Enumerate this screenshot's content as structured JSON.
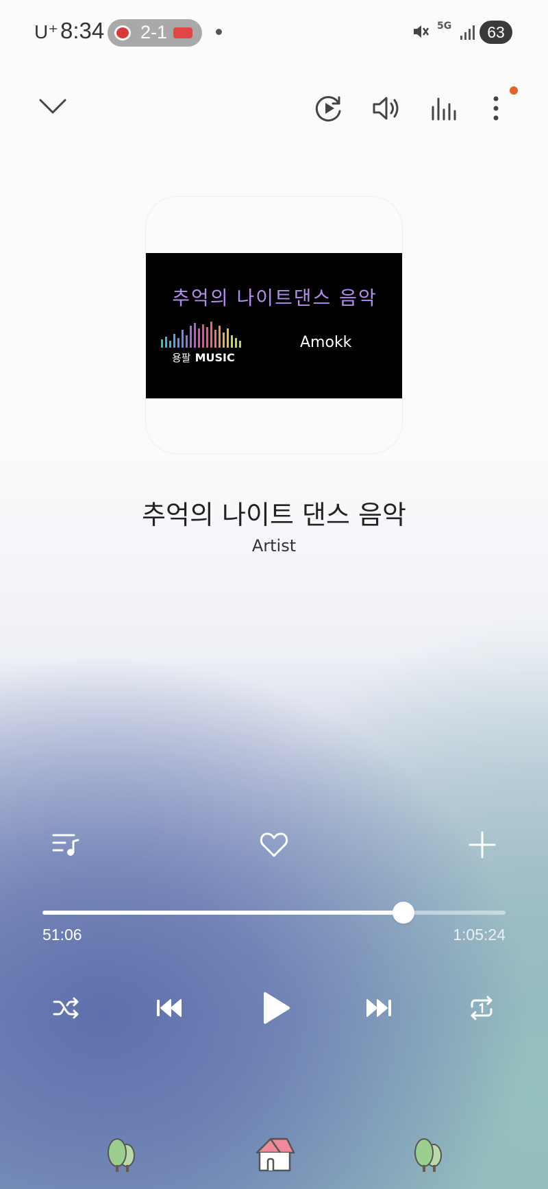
{
  "status_bar": {
    "carrier": "U⁺",
    "time": "8:34",
    "game_score": "2-1",
    "network": "5G",
    "battery": "63"
  },
  "toolbar": {
    "collapse_icon": "chevron-down-icon",
    "smart_view_icon": "play-rotate-icon",
    "volume_icon": "volume-icon",
    "equalizer_icon": "equalizer-icon",
    "more_icon": "more-vert-icon"
  },
  "album": {
    "art_title": "추억의 나이트댄스 음악",
    "art_brand_kr": "용팔",
    "art_brand": "MUSIC",
    "art_artist": "Amokk"
  },
  "track": {
    "title": "추억의 나이트 댄스 음악",
    "artist": "Artist"
  },
  "playback": {
    "current_time": "51:06",
    "total_time": "1:05:24",
    "progress": 0.78
  },
  "colors": {
    "accent_dot": "#e8632a"
  }
}
